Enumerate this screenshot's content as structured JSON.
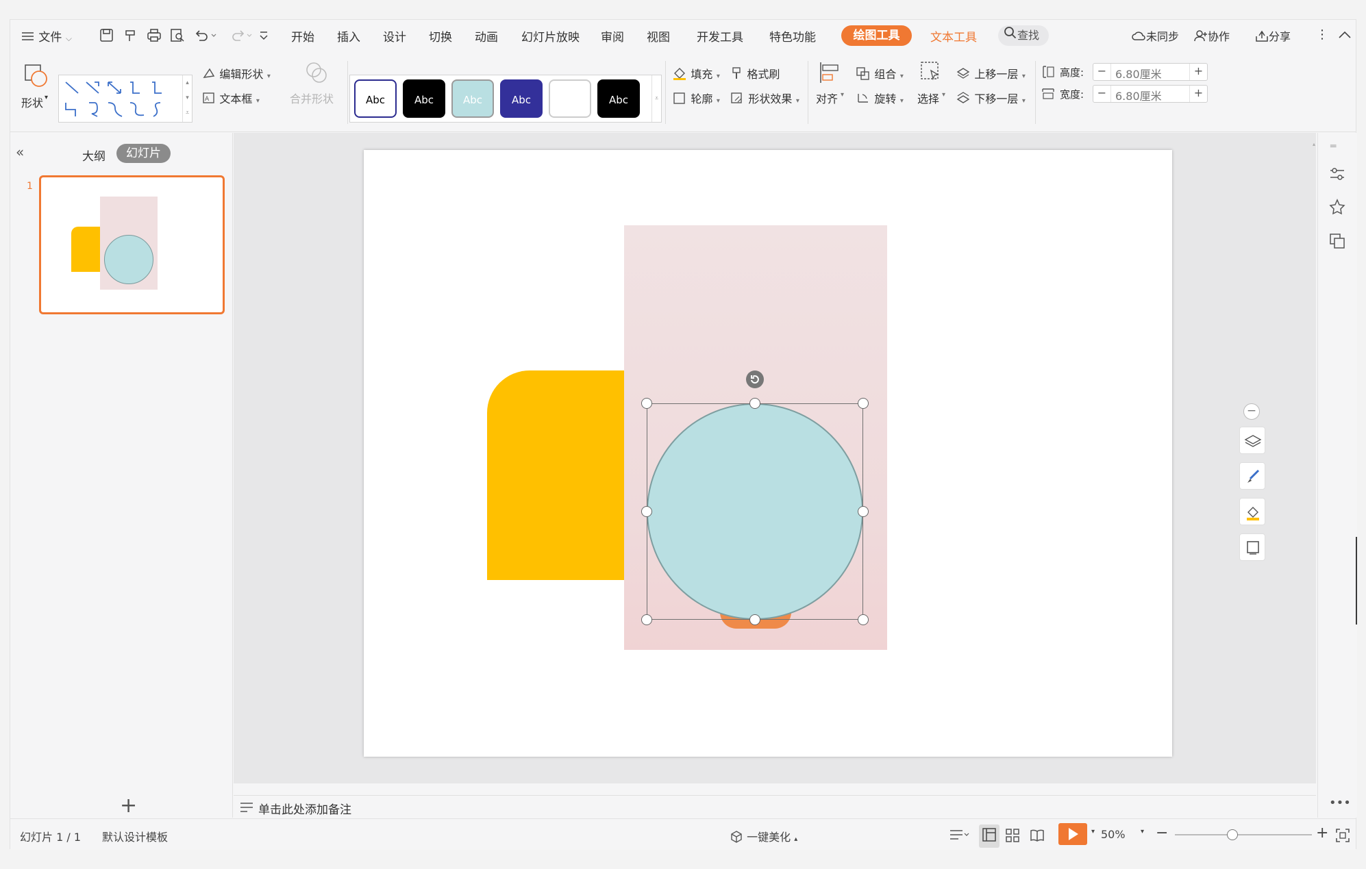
{
  "menubar": {
    "file": "文件",
    "tabs": [
      "开始",
      "插入",
      "设计",
      "切换",
      "动画",
      "幻灯片放映",
      "审阅",
      "视图",
      "开发工具",
      "特色功能"
    ],
    "drawing_tools": "绘图工具",
    "text_tools": "文本工具",
    "search": "查找",
    "sync": "未同步",
    "collab": "协作",
    "share": "分享"
  },
  "ribbon": {
    "shape": "形状",
    "edit_shape": "编辑形状",
    "text_box": "文本框",
    "merge_shape": "合并形状",
    "style_swatches": [
      {
        "label": "Abc",
        "bg": "#ffffff",
        "fg": "#000000",
        "border": "#2b2b8f"
      },
      {
        "label": "Abc",
        "bg": "#000000",
        "fg": "#ffffff",
        "border": "#000000"
      },
      {
        "label": "Abc",
        "bg": "#b9dfe2",
        "fg": "#ffffff",
        "border": "#9a9a9a"
      },
      {
        "label": "Abc",
        "bg": "#33309a",
        "fg": "#ffffff",
        "border": "#33309a"
      },
      {
        "label": "",
        "bg": "#ffffff",
        "fg": "#000000",
        "border": "#cccccc"
      },
      {
        "label": "Abc",
        "bg": "#000000",
        "fg": "#ffffff",
        "border": "#000000"
      }
    ],
    "fill": "填充",
    "format_painter": "格式刷",
    "outline": "轮廓",
    "shape_effects": "形状效果",
    "align": "对齐",
    "group": "组合",
    "rotate": "旋转",
    "select": "选择",
    "bring_forward": "上移一层",
    "send_backward": "下移一层",
    "height_label": "高度:",
    "height_value": "6.80厘米",
    "width_label": "宽度:",
    "width_value": "6.80厘米"
  },
  "leftpanel": {
    "outline_tab": "大纲",
    "slides_tab": "幻灯片",
    "slide_number": "1",
    "add": "+"
  },
  "notes": {
    "placeholder": "单击此处添加备注"
  },
  "status": {
    "slide_info": "幻灯片 1 / 1",
    "template": "默认设计模板",
    "beautify": "一键美化",
    "zoom": "50%"
  },
  "colors": {
    "accent": "#f07832",
    "yellow_shape": "#ffc000",
    "circle_fill": "#b9dfe2",
    "photo_bg": "#f0dfe0"
  }
}
